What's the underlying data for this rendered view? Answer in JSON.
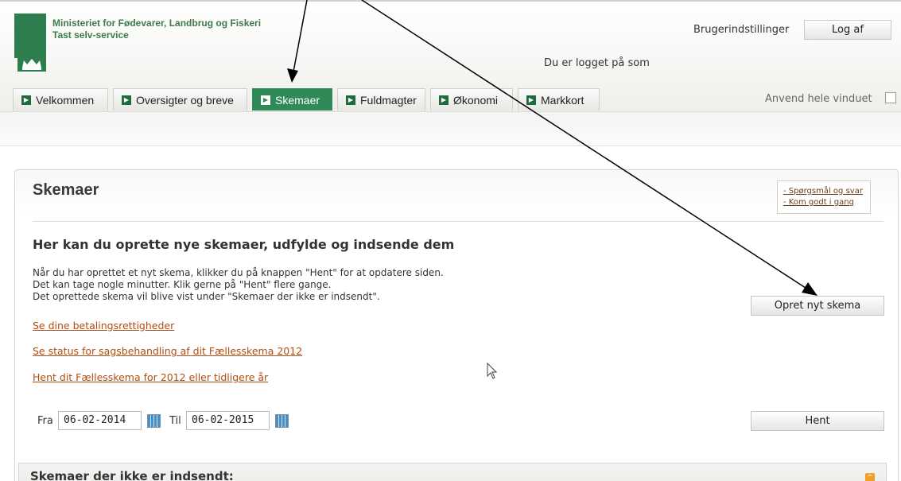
{
  "header": {
    "ministry_line1": "Ministeriet for Fødevarer, Landbrug og Fiskeri",
    "ministry_line2": "Tast selv-service",
    "user_settings": "Brugerindstillinger",
    "logout": "Log af",
    "logged_in_as": "Du er logget på som"
  },
  "tabs": [
    {
      "label": "Velkommen",
      "active": false
    },
    {
      "label": "Oversigter og breve",
      "active": false
    },
    {
      "label": "Skemaer",
      "active": true
    },
    {
      "label": "Fuldmagter",
      "active": false
    },
    {
      "label": "Økonomi",
      "active": false
    },
    {
      "label": "Markkort",
      "active": false
    }
  ],
  "full_window_label": "Anvend hele vinduet",
  "panel": {
    "title": "Skemaer",
    "help_links": [
      "- Spørgsmål og svar",
      "- Kom godt i gang"
    ],
    "heading": "Her kan du oprette nye skemaer, udfylde og indsende dem",
    "intro_lines": [
      "Når du har oprettet et nyt skema, klikker du på knappen \"Hent\" for at opdatere siden.",
      "Det kan tage nogle minutter. Klik gerne på \"Hent\" flere gange.",
      "Det oprettede skema vil blive vist under \"Skemaer der ikke er indsendt\"."
    ],
    "links": [
      "Se dine betalingsrettigheder",
      "Se status for sagsbehandling af dit Fællesskema 2012",
      "Hent dit Fællesskema for 2012 eller tidligere år"
    ],
    "create_button": "Opret nyt skema",
    "from_label": "Fra",
    "from_date": "06-02-2014",
    "to_label": "Til",
    "to_date": "06-02-2015",
    "fetch_button": "Hent",
    "section_title": "Skemaer der ikke er indsendt:"
  },
  "colors": {
    "brand_green": "#2f8a58",
    "link_brown": "#b04d12"
  }
}
